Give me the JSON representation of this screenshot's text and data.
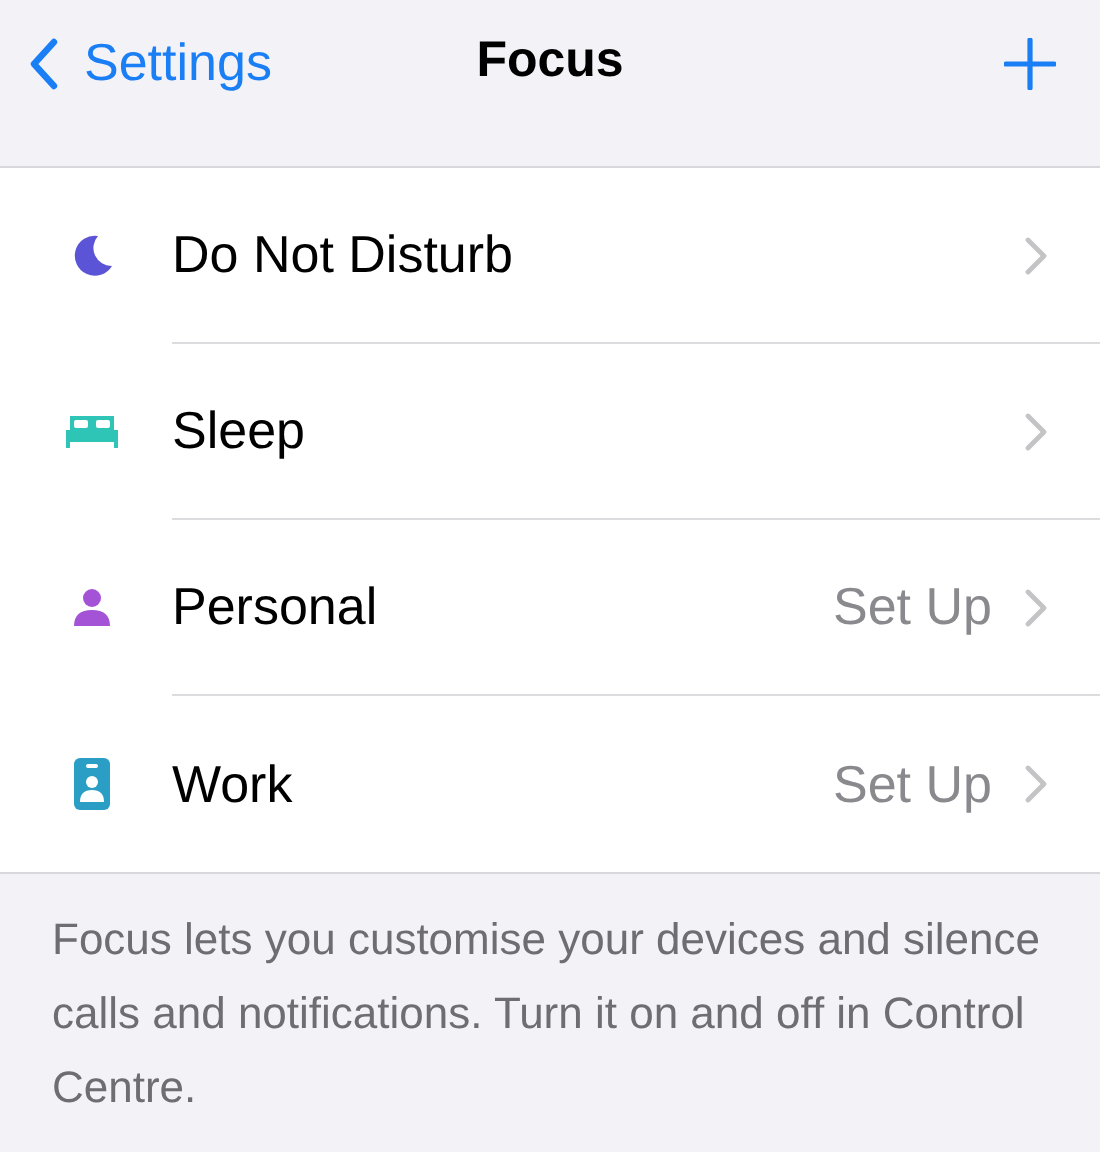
{
  "nav": {
    "back_label": "Settings",
    "title": "Focus"
  },
  "items": [
    {
      "label": "Do Not Disturb",
      "kind": "moon",
      "color": "#5b54d6"
    },
    {
      "label": "Sleep",
      "kind": "bed",
      "color": "#2ec4b6"
    },
    {
      "label": "Personal",
      "kind": "person",
      "color": "#a452d6",
      "status": "Set Up"
    },
    {
      "label": "Work",
      "kind": "badge",
      "color": "#2a9ec4",
      "status": "Set Up"
    }
  ],
  "footer": "Focus lets you customise your devices and silence calls and notifications. Turn it on and off in Control Centre."
}
